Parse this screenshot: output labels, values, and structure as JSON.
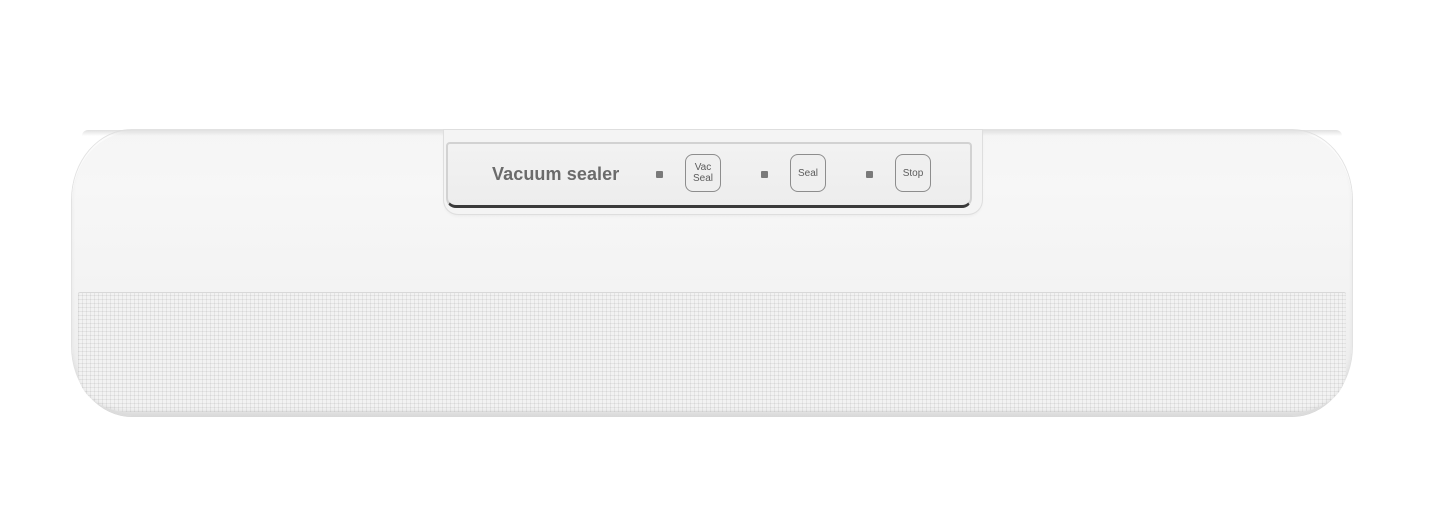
{
  "product": {
    "panel_title": "Vacuum sealer",
    "buttons": [
      {
        "id": "vac-seal",
        "line1": "Vac",
        "line2": "Seal"
      },
      {
        "id": "seal",
        "line1": "Seal",
        "line2": ""
      },
      {
        "id": "stop",
        "line1": "Stop",
        "line2": ""
      }
    ],
    "colors": {
      "body": "#f4f4f4",
      "panel_text": "#6b6b6b",
      "button_border": "#8d8d8d",
      "led": "#7a7a7a"
    }
  }
}
